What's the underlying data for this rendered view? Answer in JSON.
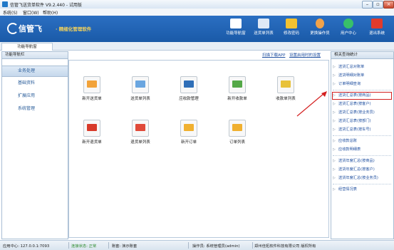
{
  "window": {
    "title": "信管飞送货单软件 V9.2.440 - 试用版"
  },
  "menu": [
    "系统(S)",
    "窗口(W)",
    "帮助(H)"
  ],
  "banner": {
    "brand": "信管飞",
    "slogan": "· 精细化管理软件"
  },
  "toolbar": [
    {
      "label": "功能导航窗",
      "icon": "navigation-icon",
      "color": "#ffffff"
    },
    {
      "label": "送货单列表",
      "icon": "list-icon",
      "color": "#dfe9f6"
    },
    {
      "label": "修改密码",
      "icon": "lock-icon",
      "color": "#f2c230"
    },
    {
      "label": "更换操作员",
      "icon": "user-icon",
      "color": "#f0a24a"
    },
    {
      "label": "用户中心",
      "icon": "globe-icon",
      "color": "#38c06a"
    },
    {
      "label": "退出系统",
      "icon": "power-icon",
      "color": "#e23b2b"
    }
  ],
  "tabs": [
    {
      "label": "功能导航窗"
    }
  ],
  "left_panel": {
    "title": "功能导航栏",
    "items": [
      "业务处理",
      "基础资料",
      "扩展应用",
      "系统管理"
    ]
  },
  "main": {
    "links": [
      "扫描下载APP",
      "设置启用时的设置"
    ],
    "functions": [
      {
        "label": "新开送货单",
        "icon": "new-delivery-icon",
        "color": "#f2a33a"
      },
      {
        "label": "送货单列表",
        "icon": "delivery-list-icon",
        "color": "#6aa6e0"
      },
      {
        "label": "应收款管理",
        "icon": "receivable-icon",
        "color": "#2f6fb8"
      },
      {
        "label": "新开收款单",
        "icon": "new-receipt-icon",
        "color": "#54a847"
      },
      {
        "label": "收款单列表",
        "icon": "receipt-list-icon",
        "color": "#e8c23a"
      },
      {
        "label": "新开退货单",
        "icon": "new-return-icon",
        "color": "#d83a2a"
      },
      {
        "label": "退货单列表",
        "icon": "return-list-icon",
        "color": "#e04a3a"
      },
      {
        "label": "新开订单",
        "icon": "new-order-icon",
        "color": "#f0b030"
      },
      {
        "label": "订单列表",
        "icon": "order-list-icon",
        "color": "#f0b030"
      }
    ]
  },
  "right_panel": {
    "title": "相关查询统计",
    "groups": [
      [
        "送货汇总对账单",
        "送货明细对账单",
        "订单明细查询"
      ],
      [
        "送货汇总表(按商品)",
        "送货汇总表(按客户)",
        "送货汇总表(按业务员)",
        "送货汇总表(按部门)",
        "送货汇总表(按车号)"
      ],
      [
        "应收款总账",
        "应收款明细表"
      ],
      [
        "送货年度汇总(按商品)",
        "送货年度汇总(按客户)",
        "送货年度汇总(按业务员)"
      ],
      [
        "经营情况表"
      ]
    ],
    "selected": "送货汇总表(按商品)"
  },
  "statusbar": {
    "app_center": "应用中心: 127.0.0.1:7093",
    "connection": "连接状态: 正常",
    "account": "账套: 演示账套",
    "operator": "操作员: 系统管理员(admin)",
    "company": "郑州佳拓软件科技有限公司 版权所有"
  }
}
